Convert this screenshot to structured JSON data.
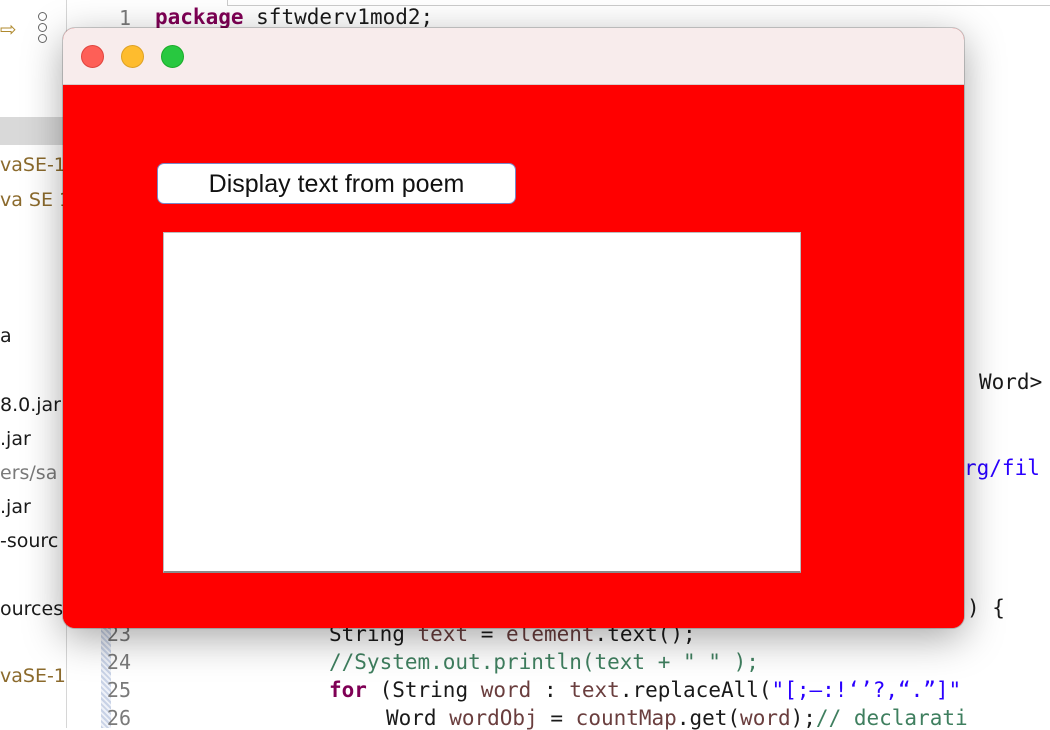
{
  "ide": {
    "sidebar_items": [
      {
        "label": "vaSE-1",
        "kind": "lib"
      },
      {
        "label": "va SE 1",
        "kind": "lib"
      },
      {
        "label": "a",
        "kind": "plain"
      },
      {
        "label": "8.0.jar",
        "kind": "plain"
      },
      {
        "label": ".jar",
        "kind": "plain"
      },
      {
        "label": "ers/sa",
        "kind": "dim"
      },
      {
        "label": ".jar",
        "kind": "plain"
      },
      {
        "label": "-sourc",
        "kind": "plain"
      },
      {
        "label": "ources.",
        "kind": "plain"
      },
      {
        "label": "vaSE-1",
        "kind": "lib"
      }
    ],
    "line_numbers": [
      "1",
      "23",
      "24",
      "25",
      "26"
    ],
    "code": {
      "line1_kw": "package",
      "line1_rest": " sftwderv1mod2;",
      "frag_word": "Word>",
      "frag_url": "rg/fil",
      "frag_brace": ") {",
      "line23_a": "String ",
      "line23_b": "text",
      "line23_c": " = ",
      "line23_d": "element",
      "line23_e": ".text();",
      "line24": "//System.out.println(text + \" \" );",
      "line25_kw": "for",
      "line25_a": " (String ",
      "line25_b": "word",
      "line25_c": " : ",
      "line25_d": "text",
      "line25_e": ".replaceAll(",
      "line25_f": "\"[;–:!‘’?,“.”]\"",
      "line26_a": "Word ",
      "line26_b": "wordObj",
      "line26_c": " = ",
      "line26_d": "countMap",
      "line26_e": ".get(",
      "line26_f": "word",
      "line26_g": ");",
      "line26_h": "// declarati"
    }
  },
  "dialog": {
    "button_label": "Display text from poem",
    "text_area_value": "",
    "background_color": "#ff0000"
  }
}
